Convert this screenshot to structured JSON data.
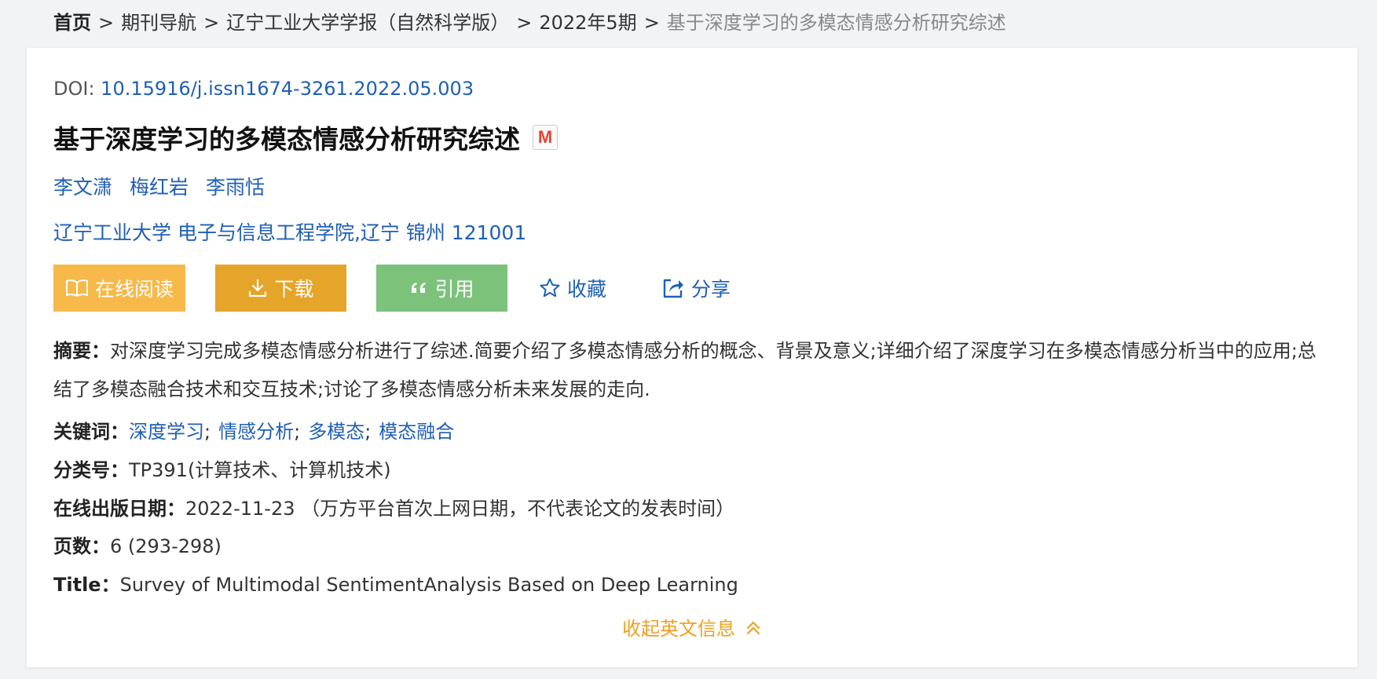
{
  "breadcrumb": {
    "home": "首页",
    "sep": ">",
    "journals": "期刊导航",
    "journal": "辽宁工业大学学报（自然科学版）",
    "issue": "2022年5期",
    "current": "基于深度学习的多模态情感分析研究综述"
  },
  "doi": {
    "label": "DOI: ",
    "value": "10.15916/j.issn1674-3261.2022.05.003"
  },
  "title": "基于深度学习的多模态情感分析研究综述",
  "badge_icon": "M",
  "authors": [
    "李文潇",
    "梅红岩",
    "李雨恬"
  ],
  "affiliation": "辽宁工业大学 电子与信息工程学院,辽宁 锦州 121001",
  "actions": {
    "read": "在线阅读",
    "download": "下载",
    "cite": "引用",
    "favorite": "收藏",
    "share": "分享"
  },
  "abstract": {
    "label": "摘要：",
    "text": "对深度学习完成多模态情感分析进行了综述.简要介绍了多模态情感分析的概念、背景及意义;详细介绍了深度学习在多模态情感分析当中的应用;总结了多模态融合技术和交互技术;讨论了多模态情感分析未来发展的走向."
  },
  "keywords": {
    "label": "关键词：",
    "items": [
      "深度学习",
      "情感分析",
      "多模态",
      "模态融合"
    ],
    "sep": ";"
  },
  "classification": {
    "label": "分类号：",
    "value": "TP391(计算技术、计算机技术)"
  },
  "online_date": {
    "label": "在线出版日期：",
    "value": "2022-11-23 （万方平台首次上网日期，不代表论文的发表时间）"
  },
  "pages": {
    "label": "页数：",
    "value": "6 (293-298)"
  },
  "english_title": {
    "label": "Title：",
    "value": "Survey of Multimodal SentimentAnalysis Based on Deep Learning"
  },
  "collapse_label": "收起英文信息",
  "colors": {
    "link": "#1f5fb4",
    "read_button": "#f6b94a",
    "download_button": "#e5a42a",
    "cite_button": "#7cc27a",
    "collapse": "#f0a020"
  }
}
